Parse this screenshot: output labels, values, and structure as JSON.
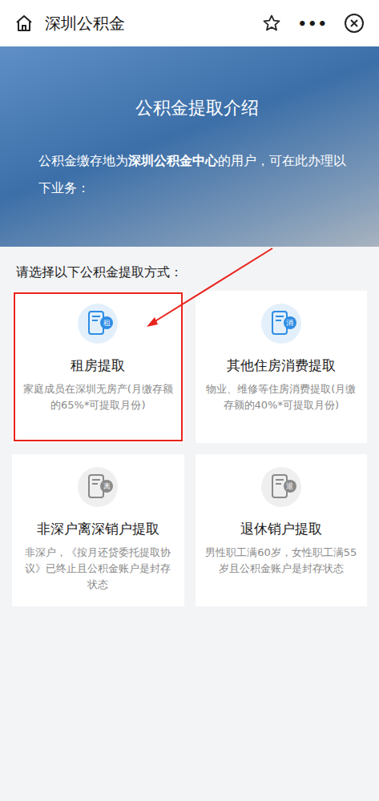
{
  "topbar": {
    "title": "深圳公积金",
    "more": "•••"
  },
  "banner": {
    "title": "公积金提取介绍",
    "intro": [
      {
        "text": "公积金缴存地为",
        "bold": false
      },
      {
        "text": "深圳公积金中心",
        "bold": true
      },
      {
        "text": "的用户，可在此办理以下业务：",
        "bold": false
      }
    ]
  },
  "section_label": "请选择以下公积金提取方式：",
  "options": [
    {
      "title": "租房提取",
      "desc": "家庭成员在深圳无房产(月缴存额的65%*可提取月份)",
      "badge": "租",
      "color": "#2f8de4",
      "highlighted": true
    },
    {
      "title": "其他住房消费提取",
      "desc": "物业、维修等住房消费提取(月缴存额的40%*可提取月份)",
      "badge": "消",
      "color": "#2f8de4",
      "highlighted": false
    },
    {
      "title": "非深户离深销户提取",
      "desc": "非深户，《按月还贷委托提取协议》已终止且公积金账户是封存状态",
      "badge": "离",
      "color": "#8a8a8a",
      "highlighted": false
    },
    {
      "title": "退休销户提取",
      "desc": "男性职工满60岁，女性职工满55岁且公积金账户是封存状态",
      "badge": "退",
      "color": "#8a8a8a",
      "highlighted": false
    }
  ]
}
